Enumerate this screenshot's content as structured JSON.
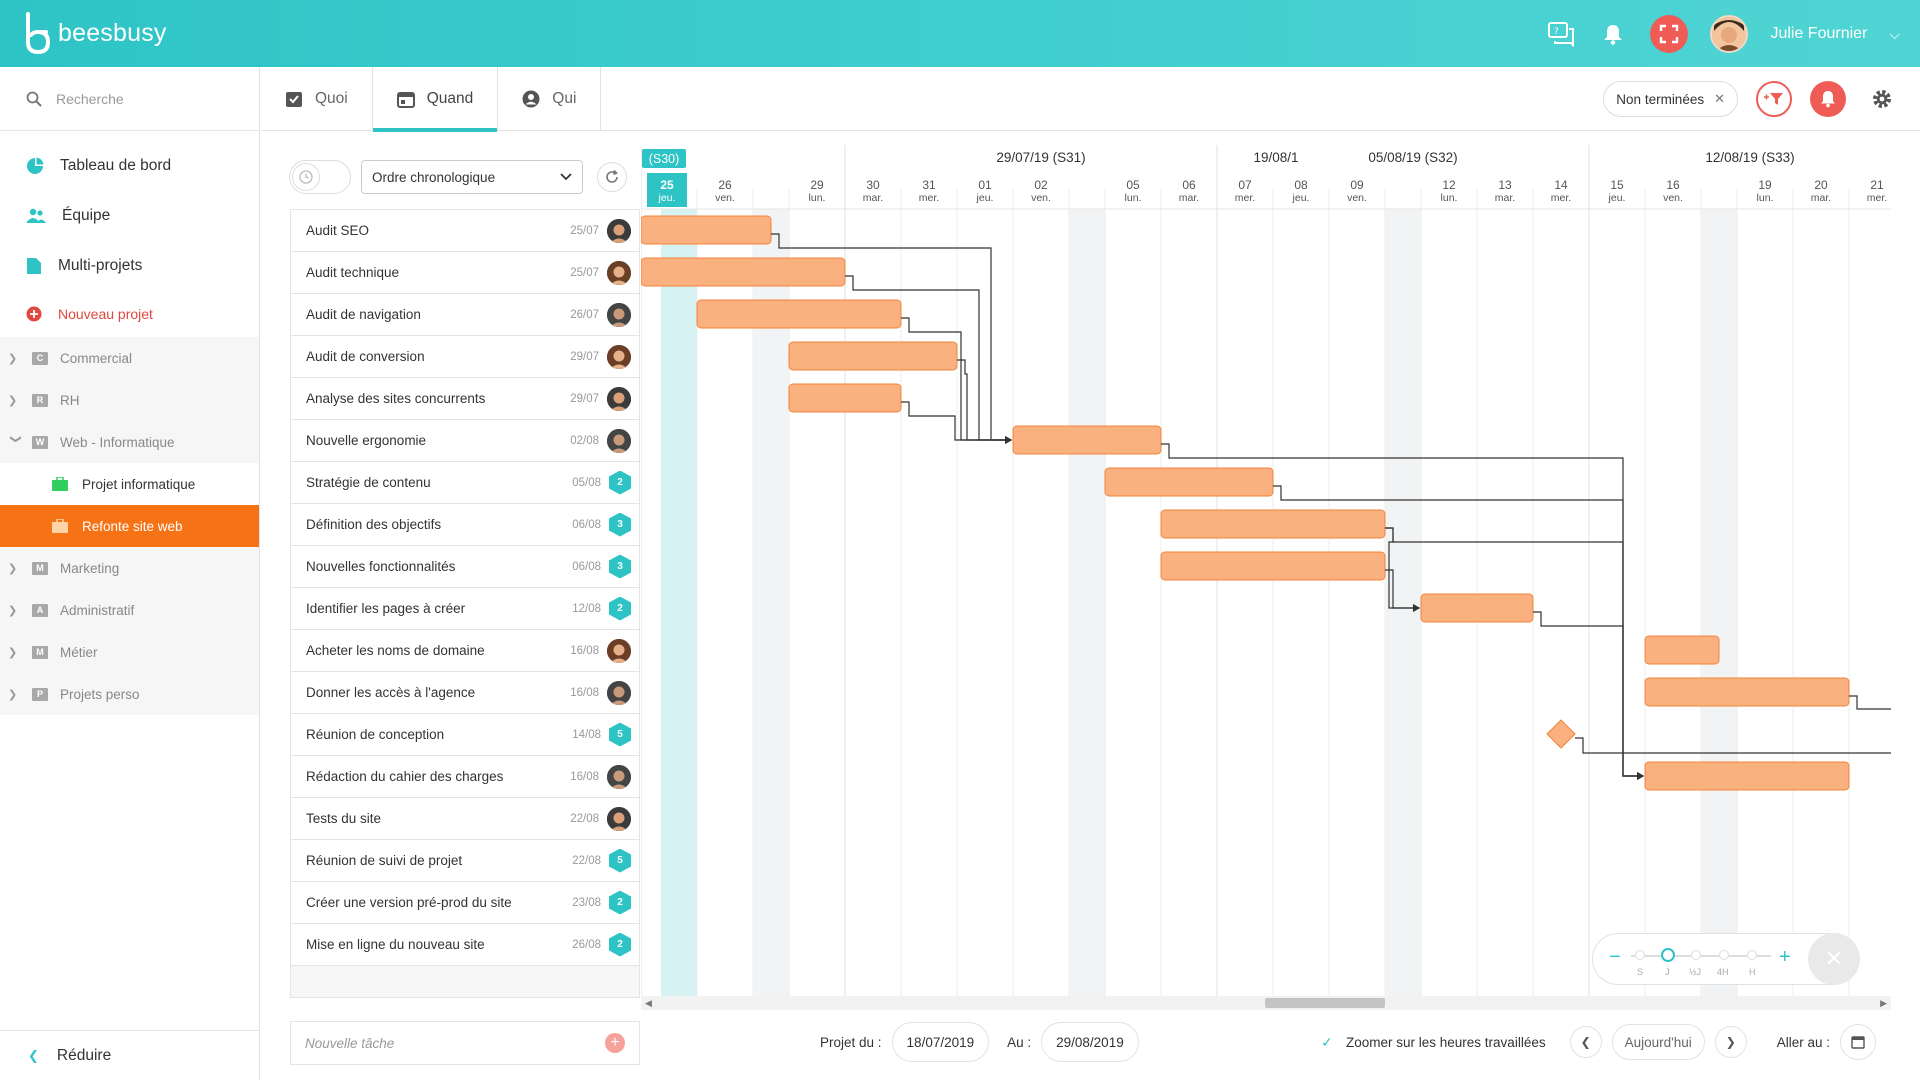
{
  "app": {
    "name": "beesbusy"
  },
  "user": {
    "name": "Julie Fournier"
  },
  "search": {
    "placeholder": "Recherche"
  },
  "nav": [
    {
      "label": "Tableau de bord",
      "icon": "dashboard-icon"
    },
    {
      "label": "Équipe",
      "icon": "team-icon"
    },
    {
      "label": "Multi-projets",
      "icon": "multi-project-icon"
    }
  ],
  "new_project": "Nouveau projet",
  "groups": [
    {
      "letter": "C",
      "label": "Commercial",
      "expanded": false
    },
    {
      "letter": "R",
      "label": "RH",
      "expanded": false
    },
    {
      "letter": "W",
      "label": "Web - Informatique",
      "expanded": true
    }
  ],
  "sub_projects": [
    {
      "label": "Projet informatique",
      "active": false
    },
    {
      "label": "Refonte site web",
      "active": true
    }
  ],
  "groups_after": [
    {
      "letter": "M",
      "label": "Marketing"
    },
    {
      "letter": "A",
      "label": "Administratif"
    },
    {
      "letter": "M",
      "label": "Métier"
    },
    {
      "letter": "P",
      "label": "Projets perso"
    }
  ],
  "collapse_label": "Réduire",
  "tabs": [
    {
      "label": "Quoi",
      "active": false
    },
    {
      "label": "Quand",
      "active": true
    },
    {
      "label": "Qui",
      "active": false
    }
  ],
  "filter_chip": "Non terminées",
  "sort_select": "Ordre chronologique",
  "tasks": [
    {
      "name": "Audit SEO",
      "date": "25/07",
      "assignee": "avatar-1"
    },
    {
      "name": "Audit technique",
      "date": "25/07",
      "assignee": "avatar-2"
    },
    {
      "name": "Audit de navigation",
      "date": "26/07",
      "assignee": "avatar-3"
    },
    {
      "name": "Audit de conversion",
      "date": "29/07",
      "assignee": "avatar-2"
    },
    {
      "name": "Analyse des sites concurrents",
      "date": "29/07",
      "assignee": "avatar-1"
    },
    {
      "name": "Nouvelle ergonomie",
      "date": "02/08",
      "assignee": "avatar-3"
    },
    {
      "name": "Stratégie de contenu",
      "date": "05/08",
      "count": "2"
    },
    {
      "name": "Définition des objectifs",
      "date": "06/08",
      "count": "3"
    },
    {
      "name": "Nouvelles fonctionnalités",
      "date": "06/08",
      "count": "3"
    },
    {
      "name": "Identifier les pages à créer",
      "date": "12/08",
      "count": "2"
    },
    {
      "name": "Acheter les noms de domaine",
      "date": "16/08",
      "assignee": "avatar-2"
    },
    {
      "name": "Donner les accès à l'agence",
      "date": "16/08",
      "assignee": "avatar-3"
    },
    {
      "name": "Réunion de conception",
      "date": "14/08",
      "count": "5"
    },
    {
      "name": "Rédaction du cahier des charges",
      "date": "16/08",
      "assignee": "avatar-3"
    },
    {
      "name": "Tests du site",
      "date": "22/08",
      "assignee": "avatar-1"
    },
    {
      "name": "Réunion de suivi de projet",
      "date": "22/08",
      "count": "5"
    },
    {
      "name": "Créer une version pré-prod du site",
      "date": "23/08",
      "count": "2"
    },
    {
      "name": "Mise en ligne du nouveau site",
      "date": "26/08",
      "count": "2"
    }
  ],
  "new_task_placeholder": "Nouvelle tâche",
  "gantt": {
    "weeks": [
      {
        "label": "(S30)",
        "startDay": 0,
        "current": true
      },
      {
        "label": "29/07/19 (S31)",
        "startDay": 4
      },
      {
        "label": "05/08/19 (S32)",
        "startDay": 11
      },
      {
        "label": "12/08/19 (S33)",
        "startDay": 18
      },
      {
        "label": "19/08/1",
        "startDay": 25
      }
    ],
    "days": [
      {
        "num": "25",
        "dow": "jeu.",
        "today": true
      },
      {
        "num": "26",
        "dow": "ven."
      },
      {
        "num": "",
        "dow": "",
        "weekend": true
      },
      {
        "num": "29",
        "dow": "lun."
      },
      {
        "num": "30",
        "dow": "mar."
      },
      {
        "num": "31",
        "dow": "mer."
      },
      {
        "num": "01",
        "dow": "jeu."
      },
      {
        "num": "02",
        "dow": "ven."
      },
      {
        "num": "",
        "dow": "",
        "weekend": true
      },
      {
        "num": "05",
        "dow": "lun."
      },
      {
        "num": "06",
        "dow": "mar."
      },
      {
        "num": "07",
        "dow": "mer."
      },
      {
        "num": "08",
        "dow": "jeu."
      },
      {
        "num": "09",
        "dow": "ven."
      },
      {
        "num": "",
        "dow": "",
        "weekend": true
      },
      {
        "num": "12",
        "dow": "lun."
      },
      {
        "num": "13",
        "dow": "mar."
      },
      {
        "num": "14",
        "dow": "mer."
      },
      {
        "num": "15",
        "dow": "jeu."
      },
      {
        "num": "16",
        "dow": "ven."
      },
      {
        "num": "",
        "dow": "",
        "weekend": true
      },
      {
        "num": "19",
        "dow": "lun."
      },
      {
        "num": "20",
        "dow": "mar."
      },
      {
        "num": "21",
        "dow": "mer."
      }
    ],
    "bars": [
      {
        "row": 0,
        "start": "25/07",
        "end": "28/07"
      },
      {
        "row": 1,
        "start": "25/07",
        "end": "29/07"
      },
      {
        "row": 2,
        "start": "26/07",
        "end": "30/07"
      },
      {
        "row": 3,
        "start": "29/07",
        "end": "31/07"
      },
      {
        "row": 4,
        "start": "29/07",
        "end": "30/07"
      },
      {
        "row": 5,
        "start": "02/08",
        "end": "05/08"
      },
      {
        "row": 6,
        "start": "05/08",
        "end": "07/08"
      },
      {
        "row": 7,
        "start": "06/08",
        "end": "09/08"
      },
      {
        "row": 8,
        "start": "06/08",
        "end": "09/08"
      },
      {
        "row": 9,
        "start": "12/08",
        "end": "13/08"
      },
      {
        "row": 10,
        "start": "16/08",
        "end": "18/08"
      },
      {
        "row": 11,
        "start": "16/08",
        "end": "20/08"
      },
      {
        "row": 12,
        "milestone": "14/08"
      },
      {
        "row": 13,
        "start": "16/08",
        "end": "20/08"
      }
    ]
  },
  "zoom": {
    "labels": [
      "S",
      "J",
      "½J",
      "4H",
      "H"
    ],
    "selected": "J"
  },
  "project_from_label": "Projet du :",
  "project_from": "18/07/2019",
  "project_to_label": "Au :",
  "project_to": "29/08/2019",
  "zoom_hours_label": "Zoomer sur les heures travaillées",
  "today_label": "Aujourd'hui",
  "goto_label": "Aller au :",
  "colors": {
    "accent": "#2ec4c6",
    "bar": "#fbb07f",
    "bar_border": "#f0853a",
    "active_project": "#f57215",
    "danger": "#ef5b55"
  }
}
